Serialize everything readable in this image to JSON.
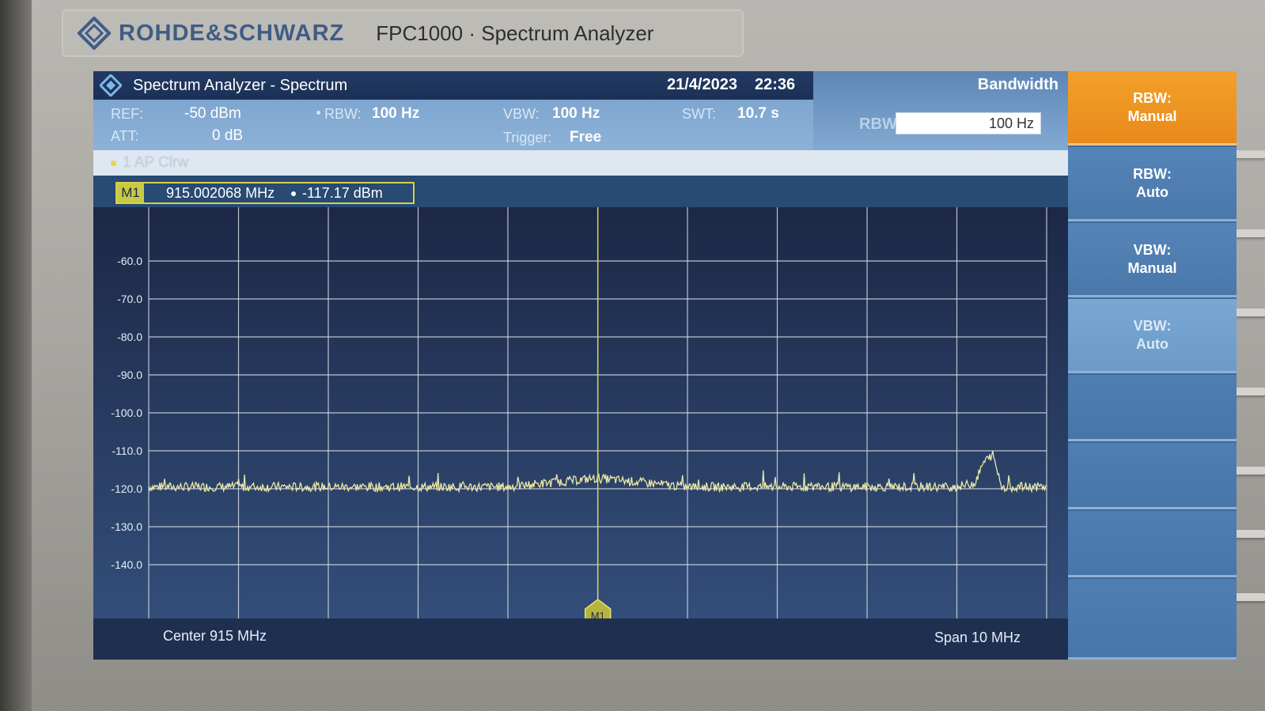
{
  "device": {
    "brand": "ROHDE&SCHWARZ",
    "model": "FPC1000 · Spectrum Analyzer"
  },
  "titlebar": {
    "title": "Spectrum Analyzer - Spectrum",
    "date": "21/4/2023",
    "time": "22:36"
  },
  "params": {
    "ref_label": "REF:",
    "ref_value": "-50 dBm",
    "att_label": "ATT:",
    "att_value": "0 dB",
    "rbw_label": "RBW:",
    "rbw_value": "100 Hz",
    "vbw_label": "VBW:",
    "vbw_value": "100 Hz",
    "trigger_label": "Trigger:",
    "trigger_value": "Free",
    "swt_label": "SWT:",
    "swt_value": "10.7 s"
  },
  "bandwidth_panel": {
    "heading": "Bandwidth",
    "field_label": "RBW",
    "field_value": "100 Hz"
  },
  "trace": {
    "label": "1 AP  Clrw",
    "color": "#e8d34a"
  },
  "marker": {
    "tag": "M1",
    "frequency": "915.002068 MHz",
    "level": "-117.17 dBm",
    "plot_tag": "M1"
  },
  "plot": {
    "y_ticks": [
      "-60.0",
      "-70.0",
      "-80.0",
      "-90.0",
      "-100.0",
      "-110.0",
      "-120.0",
      "-130.0",
      "-140.0"
    ],
    "center_label": "Center 915 MHz",
    "span_label": "Span 10 MHz",
    "grid_color": "#d7dde6",
    "trace_color": "#ece8a6",
    "marker_color": "#d8d84a"
  },
  "chart_data": {
    "type": "line",
    "xlabel": "",
    "ylabel": "",
    "x_range_mhz": [
      910,
      920
    ],
    "ylim": [
      -150,
      -50
    ],
    "series": [
      {
        "x": [
          910.0,
          911.0,
          912.0,
          913.0,
          914.0,
          915.0,
          916.0,
          917.0,
          918.0,
          919.0,
          919.2,
          919.3,
          919.4,
          919.5,
          920.0
        ],
        "values": [
          -119.5,
          -119.5,
          -119.5,
          -119.5,
          -119.5,
          -117.2,
          -119.5,
          -119.5,
          -119.5,
          -119.5,
          -118.5,
          -113.0,
          -111.0,
          -119.5,
          -119.5
        ]
      }
    ]
  },
  "softkeys": [
    {
      "label": "RBW:\nManual",
      "state": "active"
    },
    {
      "label": "RBW:\nAuto",
      "state": "normal"
    },
    {
      "label": "VBW:\nManual",
      "state": "normal"
    },
    {
      "label": "VBW:\nAuto",
      "state": "dim"
    },
    {
      "label": "",
      "state": "empty"
    },
    {
      "label": "",
      "state": "empty"
    },
    {
      "label": "",
      "state": "empty"
    },
    {
      "label": "",
      "state": "empty"
    }
  ]
}
